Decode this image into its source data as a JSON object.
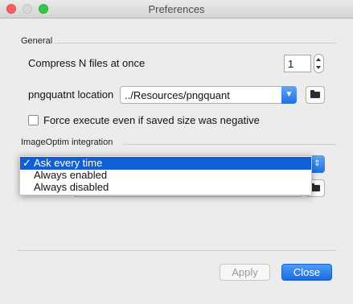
{
  "window": {
    "title": "Preferences"
  },
  "general": {
    "section_label": "General",
    "compress_label": "Compress N files at once",
    "compress_value": "1",
    "location_label": "pngquatnt location",
    "location_value": "../Resources/pngquant",
    "force_label": "Force execute even if saved size was negative",
    "force_checked": false
  },
  "imageoptim": {
    "section_label": "ImageOptim integration",
    "menu": {
      "items": [
        {
          "label": "Ask every time",
          "selected": true,
          "check": "✓"
        },
        {
          "label": "Always enabled",
          "selected": false
        },
        {
          "label": "Always disabled",
          "selected": false
        }
      ]
    }
  },
  "buttons": {
    "apply": "Apply",
    "close": "Close"
  }
}
